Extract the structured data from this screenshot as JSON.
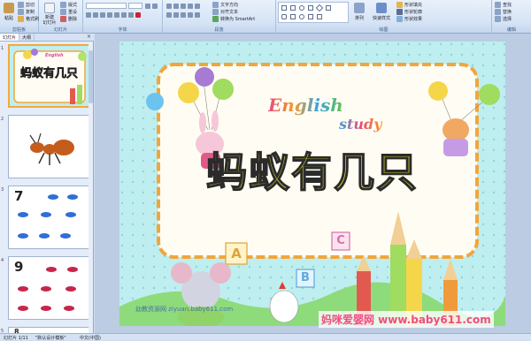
{
  "ribbon": {
    "clipboard_label": "剪贴板",
    "paste": "粘贴",
    "cut": "剪切",
    "copy": "复制",
    "format_painter": "格式刷",
    "slides_label": "幻灯片",
    "new_slide": "新建\n幻灯片",
    "layout": "版式",
    "reset": "重设",
    "delete": "删除",
    "font_label": "字体",
    "paragraph_label": "段落",
    "text_direction": "文字方向",
    "align_text": "对齐文本",
    "smartart": "转换为 SmartArt",
    "drawing_label": "绘图",
    "arrange": "排列",
    "quick_styles": "快速样式",
    "shape_fill": "形状填充",
    "shape_outline": "形状轮廓",
    "shape_effects": "形状效果",
    "editing_label": "编辑",
    "find": "查找",
    "replace": "替换",
    "select": "选择"
  },
  "panel": {
    "tab_slides": "幻灯片",
    "tab_outline": "大纲",
    "close": "×",
    "thumbnails": [
      {
        "num": "1",
        "title": "蚂蚁有几只"
      },
      {
        "num": "2",
        "title": ""
      },
      {
        "num": "3",
        "title": "7"
      },
      {
        "num": "4",
        "title": "9"
      },
      {
        "num": "5",
        "title": "8"
      }
    ]
  },
  "slide": {
    "english_word": "English",
    "study_word": "study",
    "title": "蚂蚁有几只",
    "site_text": "幼教资源网 ziyuan.baby611.com",
    "watermark": "妈咪爱婴网 www.baby611.com",
    "block_letters": [
      "A",
      "B",
      "C"
    ]
  },
  "status": {
    "slide_count": "幻灯片 1/11",
    "theme": "\"默认设计模板\"",
    "language": "中文(中国)"
  },
  "colors": {
    "title_fill": "#f4f12a",
    "slide_bg": "#bfeef0",
    "ribbon_bg": "#d5e3f5",
    "selection": "#f3a93c",
    "watermark": "#f04c84"
  }
}
